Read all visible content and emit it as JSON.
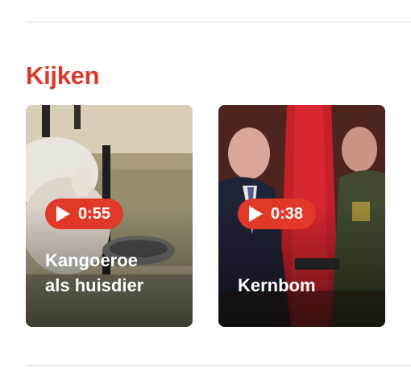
{
  "section": {
    "title": "Kijken",
    "accent_color": "#d93a2b"
  },
  "videos": [
    {
      "duration": "0:55",
      "title_line1": "Kangoeroe",
      "title_line2": "als huisdier",
      "icon": "play-icon"
    },
    {
      "duration": "0:38",
      "title_line1": "Kernbom",
      "icon": "play-icon"
    }
  ]
}
